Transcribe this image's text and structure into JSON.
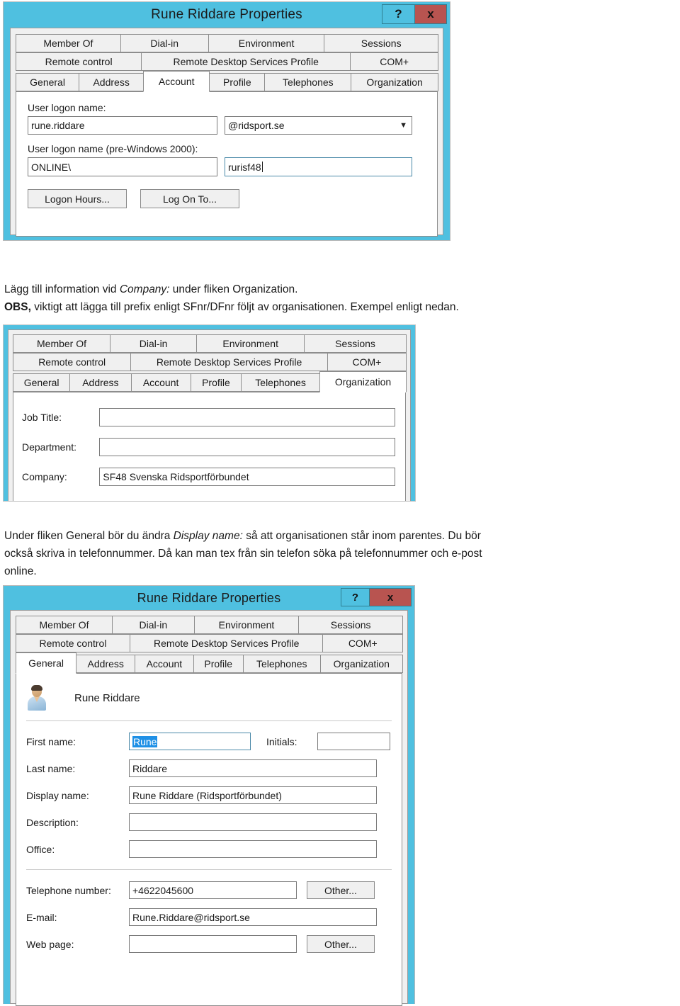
{
  "document": {
    "language": "sv",
    "colors": {
      "titlebar": "#4FC0E0",
      "close_button": "#b85450",
      "dialog_face": "#f0f0f0",
      "panel": "#ffffff",
      "selection": "#1e90e6",
      "text": "#1a1a1a"
    }
  },
  "dialog_account": {
    "title": "Rune Riddare Properties",
    "help_button": "?",
    "close_button": "x",
    "tabs_row1": [
      "Member Of",
      "Dial-in",
      "Environment",
      "Sessions"
    ],
    "tabs_row2": [
      "Remote control",
      "Remote Desktop Services Profile",
      "COM+"
    ],
    "tabs_row3": [
      "General",
      "Address",
      "Account",
      "Profile",
      "Telephones",
      "Organization"
    ],
    "active_tab": "Account",
    "fields": {
      "user_logon_name_label": "User logon name:",
      "user_logon_name_value": "rune.riddare",
      "upn_suffix_value": "@ridsport.se",
      "pre2000_label": "User logon name (pre-Windows 2000):",
      "pre2000_domain_value": "ONLINE\\",
      "pre2000_name_value": "rurisf48"
    },
    "buttons": {
      "logon_hours": "Logon Hours...",
      "log_on_to": "Log On To..."
    }
  },
  "paragraph_1": {
    "line1_pre": "Lägg till information vid ",
    "line1_em": "Company:",
    "line1_post": " under fliken Organization.",
    "line2_bold": "OBS,",
    "line2_rest": " viktigt att lägga till prefix enligt SFnr/DFnr följt av organisationen. Exempel enligt nedan."
  },
  "dialog_organization": {
    "tabs_row1": [
      "Member Of",
      "Dial-in",
      "Environment",
      "Sessions"
    ],
    "tabs_row2": [
      "Remote control",
      "Remote Desktop Services Profile",
      "COM+"
    ],
    "tabs_row3": [
      "General",
      "Address",
      "Account",
      "Profile",
      "Telephones",
      "Organization"
    ],
    "active_tab": "Organization",
    "fields": {
      "job_title_label": "Job Title:",
      "job_title_value": "",
      "department_label": "Department:",
      "department_value": "",
      "company_label": "Company:",
      "company_value": "SF48 Svenska Ridsportförbundet"
    }
  },
  "paragraph_2": {
    "line1_pre": "Under fliken General bör du ändra ",
    "line1_em": "Display name:",
    "line1_post": " så att organisationen står inom parentes. Du bör",
    "line2": "också skriva in telefonnummer. Då kan man tex från sin telefon söka på telefonnummer och e-post",
    "line3": "online."
  },
  "dialog_general": {
    "title": "Rune Riddare Properties",
    "help_button": "?",
    "close_button": "x",
    "tabs_row1": [
      "Member Of",
      "Dial-in",
      "Environment",
      "Sessions"
    ],
    "tabs_row2": [
      "Remote control",
      "Remote Desktop Services Profile",
      "COM+"
    ],
    "tabs_row3": [
      "General",
      "Address",
      "Account",
      "Profile",
      "Telephones",
      "Organization"
    ],
    "active_tab": "General",
    "header_name": "Rune Riddare",
    "avatar_icon": "user-avatar-icon",
    "fields": {
      "first_name_label": "First name:",
      "first_name_value": "Rune",
      "first_name_selected": true,
      "initials_label": "Initials:",
      "initials_value": "",
      "last_name_label": "Last name:",
      "last_name_value": "Riddare",
      "display_name_label": "Display name:",
      "display_name_value": "Rune Riddare (Ridsportförbundet)",
      "description_label": "Description:",
      "description_value": "",
      "office_label": "Office:",
      "office_value": "",
      "telephone_label": "Telephone number:",
      "telephone_value": "+4622045600",
      "telephone_other_button": "Other...",
      "email_label": "E-mail:",
      "email_value": "Rune.Riddare@ridsport.se",
      "webpage_label": "Web page:",
      "webpage_value": "",
      "webpage_other_button": "Other..."
    }
  }
}
